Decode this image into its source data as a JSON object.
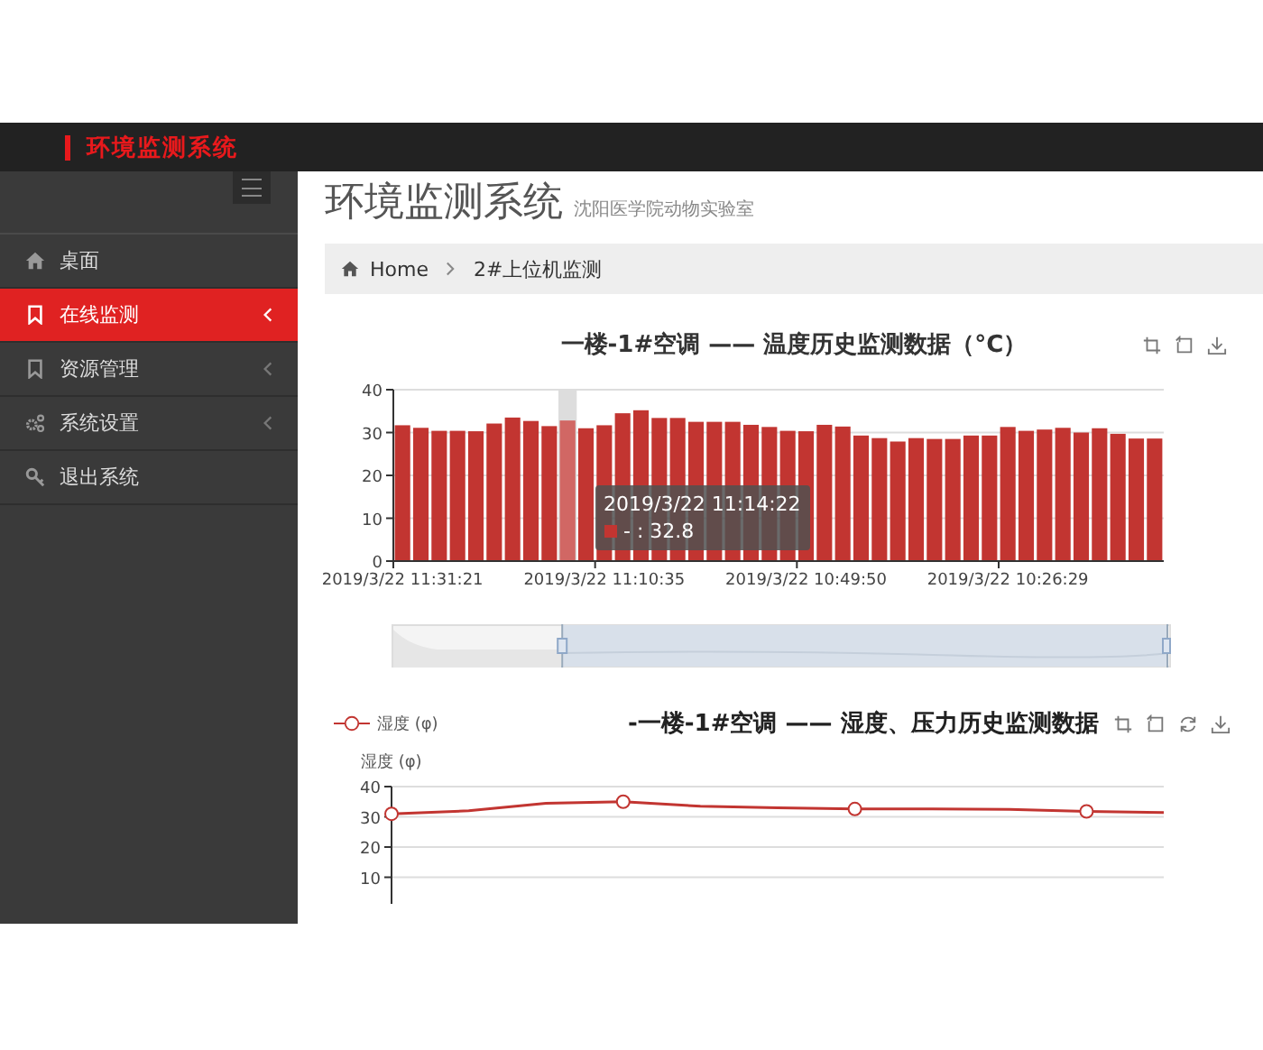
{
  "header": {
    "title": "环境监测系统"
  },
  "sidebar": {
    "items": [
      {
        "label": "桌面",
        "kind": "home",
        "selected": false,
        "has_submenu": false
      },
      {
        "label": "在线监测",
        "kind": "bookmark",
        "selected": true,
        "has_submenu": true
      },
      {
        "label": "资源管理",
        "kind": "bookmark",
        "selected": false,
        "has_submenu": true
      },
      {
        "label": "系统设置",
        "kind": "gears",
        "selected": false,
        "has_submenu": true
      },
      {
        "label": "退出系统",
        "kind": "key",
        "selected": false,
        "has_submenu": false
      }
    ]
  },
  "page": {
    "title": "环境监测系统",
    "subtitle": "沈阳医学院动物实验室"
  },
  "breadcrumb": [
    {
      "label": "Home",
      "kind": "home"
    },
    {
      "label": "2#上位机监测",
      "kind": "page"
    }
  ],
  "temperature_panel": {
    "tools": [
      {
        "kind": "zoom"
      },
      {
        "kind": "zoom-reset"
      },
      {
        "kind": "download"
      }
    ],
    "data_zoom": {
      "level": 0.78
    },
    "tooltip": {
      "title": "2019/3/22 11:14:22",
      "text": "- : 32.8"
    },
    "chart_data": {
      "type": "bar",
      "title": "一楼-1#空调 —— 温度历史监测数据（°C）",
      "categories": [
        "2019/3/22 11:31:21",
        null,
        null,
        null,
        null,
        null,
        null,
        null,
        null,
        null,
        null,
        "2019/3/22 11:10:35",
        null,
        null,
        null,
        null,
        null,
        null,
        null,
        null,
        null,
        null,
        "2019/3/22 10:49:50",
        null,
        null,
        null,
        null,
        null,
        null,
        null,
        null,
        null,
        null,
        "2019/3/22 10:26:29",
        null,
        null,
        null,
        null,
        null,
        null,
        null,
        null
      ],
      "series": [
        {
          "color": "#c23531",
          "values": [
            31.7,
            31.1,
            30.4,
            30.4,
            30.3,
            32.1,
            33.5,
            32.7,
            31.5,
            32.8,
            31.0,
            31.7,
            34.5,
            35.2,
            33.4,
            33.4,
            32.5,
            32.5,
            32.5,
            31.8,
            31.3,
            30.4,
            30.3,
            31.8,
            31.4,
            29.3,
            28.7,
            27.9,
            28.7,
            28.5,
            28.5,
            29.3,
            29.3,
            31.3,
            30.4,
            30.7,
            31.1,
            30.0,
            31.0,
            29.7,
            28.6,
            28.6
          ]
        }
      ],
      "ylim": [
        0,
        40
      ],
      "yticks": [
        0,
        10,
        20,
        30,
        40
      ],
      "grid": true
    }
  },
  "humidity_panel": {
    "tools": [
      {
        "kind": "zoom"
      },
      {
        "kind": "zoom-reset"
      },
      {
        "kind": "restore"
      },
      {
        "kind": "download"
      }
    ],
    "chart_data": {
      "type": "line",
      "title": "-一楼-1#空调 —— 湿度、压力历史监测数据",
      "ylabel": "湿度 (φ)",
      "series": [
        {
          "name": "湿度 (φ)",
          "color": "#c23531",
          "values": [
            31.0,
            32.0,
            34.5,
            35.0,
            33.5,
            33.0,
            32.6,
            32.6,
            32.5,
            31.8,
            31.4
          ]
        }
      ],
      "ylim": [
        0,
        40
      ],
      "yticks": [
        10,
        20,
        30,
        40
      ],
      "grid": true
    }
  }
}
